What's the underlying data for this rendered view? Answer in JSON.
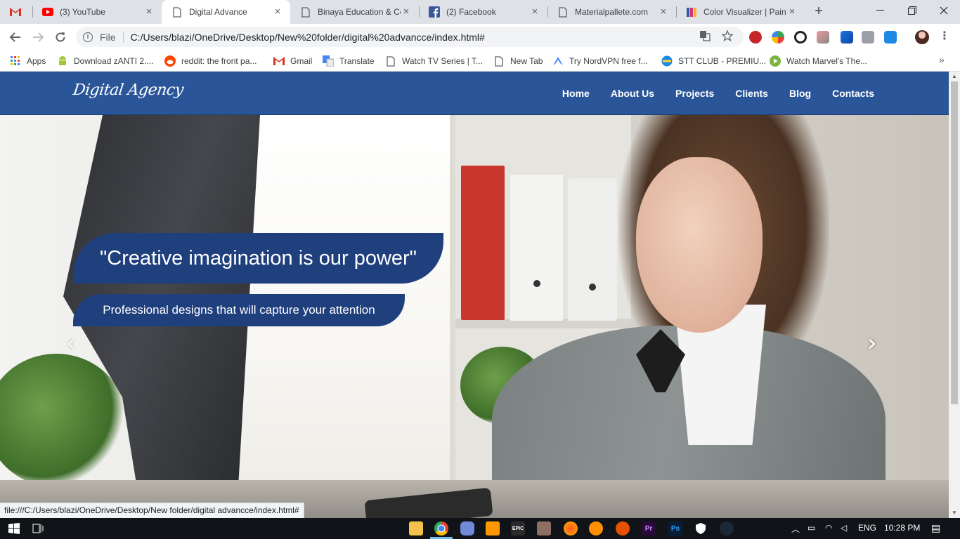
{
  "browser": {
    "tabs": [
      {
        "title": "",
        "icon": "gmail-icon"
      },
      {
        "title": "(3) YouTube",
        "icon": "youtube-icon"
      },
      {
        "title": "Digital Advance",
        "icon": "page-icon",
        "active": true
      },
      {
        "title": "Binaya Education & Co",
        "icon": "page-icon"
      },
      {
        "title": "(2) Facebook",
        "icon": "facebook-icon"
      },
      {
        "title": "Materialpallete.com",
        "icon": "page-icon"
      },
      {
        "title": "Color Visualizer | Paint",
        "icon": "color-visualizer-icon"
      }
    ],
    "address": {
      "scheme": "File",
      "url": "C:/Users/blazi/OneDrive/Desktop/New%20folder/digital%20advancce/index.html#"
    },
    "bookmarks": [
      {
        "label": "Apps",
        "icon": "apps-grid-icon"
      },
      {
        "label": "Download zANTI 2....",
        "icon": "android-icon"
      },
      {
        "label": "reddit: the front pa...",
        "icon": "reddit-icon"
      },
      {
        "label": "Gmail",
        "icon": "gmail-icon"
      },
      {
        "label": "Translate",
        "icon": "translate-icon"
      },
      {
        "label": "Watch TV Series | T...",
        "icon": "page-icon"
      },
      {
        "label": "New Tab",
        "icon": "page-icon"
      },
      {
        "label": "Try NordVPN free f...",
        "icon": "nordvpn-icon"
      },
      {
        "label": "STT CLUB - PREMIU...",
        "icon": "stt-club-icon"
      },
      {
        "label": "Watch Marvel's The...",
        "icon": "play-icon"
      }
    ],
    "more_bookmarks": "»",
    "status_url": "file:///C:/Users/blazi/OneDrive/Desktop/New folder/digital advancce/index.html#"
  },
  "site": {
    "logo": "Digital Agency",
    "menu": [
      "Home",
      "About Us",
      "Projects",
      "Clients",
      "Blog",
      "Contacts"
    ],
    "hero": {
      "headline": "\"Creative imagination is our power\"",
      "subline": "Professional designs that will capture your attention",
      "prev_arrow": "‹",
      "next_arrow": "›"
    },
    "colors": {
      "nav": "#2a5699",
      "caption": "#1f3f7d"
    }
  },
  "taskbar": {
    "language": "ENG",
    "time": "10:28 PM"
  }
}
